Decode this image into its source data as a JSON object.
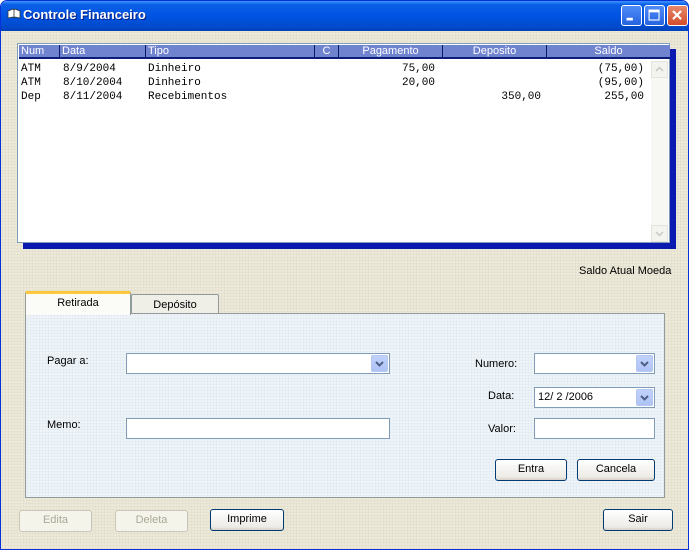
{
  "window": {
    "title": "Controle Financeiro",
    "icon": "book-icon",
    "controls": [
      "minimize",
      "maximize",
      "close"
    ]
  },
  "ledger": {
    "columns": [
      "Num",
      "Data",
      "Tipo",
      "C",
      "Pagamento",
      "Deposito",
      "Saldo"
    ],
    "rows": [
      {
        "num": "ATM",
        "data": "8/9/2004",
        "tipo": "Dinheiro",
        "c": "",
        "pagamento": "75,00",
        "deposito": "",
        "saldo": "(75,00)"
      },
      {
        "num": "ATM",
        "data": "8/10/2004",
        "tipo": "Dinheiro",
        "c": "",
        "pagamento": "20,00",
        "deposito": "",
        "saldo": "(95,00)"
      },
      {
        "num": "Dep",
        "data": "8/11/2004",
        "tipo": "Recebimentos",
        "c": "",
        "pagamento": "",
        "deposito": "350,00",
        "saldo": "255,00"
      }
    ]
  },
  "saldo_atual": "Saldo Atual  Moeda",
  "tabs": [
    {
      "label": "Retirada",
      "active": true
    },
    {
      "label": "Depósito",
      "active": false
    }
  ],
  "form": {
    "pagar_a_label": "Pagar a:",
    "pagar_a_value": "",
    "memo_label": "Memo:",
    "memo_value": "",
    "numero_label": "Numero:",
    "numero_value": "",
    "data_label": "Data:",
    "data_value": "12/ 2 /2006",
    "valor_label": "Valor:",
    "valor_value": "",
    "entra_label": "Entra",
    "cancela_label": "Cancela"
  },
  "bottom_buttons": {
    "edita": "Edita",
    "deleta": "Deleta",
    "imprime": "Imprime",
    "sair": "Sair"
  },
  "colors": {
    "title_bar": "#0054e3",
    "list_header": "#7083cf",
    "list_shadow": "#0a1ab0",
    "tab_highlight": "#ffc83c"
  }
}
